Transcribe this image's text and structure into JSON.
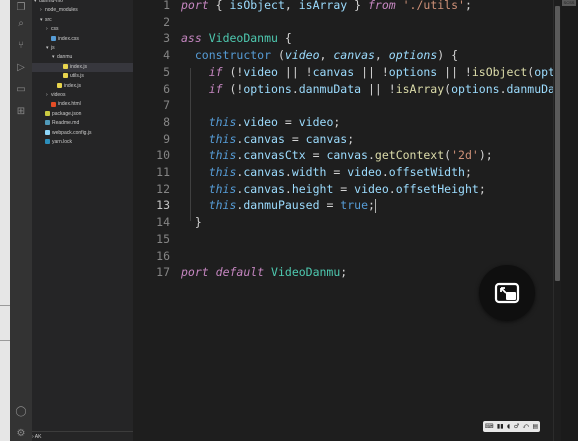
{
  "editor": {
    "lines": [
      {
        "n": "1",
        "tokens": [
          [
            "k",
            "port"
          ],
          [
            "o",
            " { "
          ],
          [
            "v",
            "isObject"
          ],
          [
            "o",
            ", "
          ],
          [
            "v",
            "isArray"
          ],
          [
            "o",
            " } "
          ],
          [
            "k",
            "from"
          ],
          [
            "o",
            " "
          ],
          [
            "s",
            "'./utils'"
          ],
          [
            "o",
            ";"
          ]
        ]
      },
      {
        "n": "2",
        "tokens": []
      },
      {
        "n": "3",
        "tokens": [
          [
            "k",
            "ass"
          ],
          [
            "o",
            " "
          ],
          [
            "c",
            "VideoDanmu"
          ],
          [
            "o",
            " {"
          ]
        ]
      },
      {
        "n": "4",
        "tokens": [
          [
            "o",
            "  "
          ],
          [
            "b",
            "constructor"
          ],
          [
            "o",
            " ("
          ],
          [
            "p",
            "video"
          ],
          [
            "o",
            ", "
          ],
          [
            "p",
            "canvas"
          ],
          [
            "o",
            ", "
          ],
          [
            "p",
            "options"
          ],
          [
            "o",
            ") {"
          ]
        ]
      },
      {
        "n": "5",
        "tokens": [
          [
            "o",
            "    "
          ],
          [
            "k",
            "if"
          ],
          [
            "o",
            " (!"
          ],
          [
            "v",
            "video"
          ],
          [
            "o",
            " || !"
          ],
          [
            "v",
            "canvas"
          ],
          [
            "o",
            " || !"
          ],
          [
            "v",
            "options"
          ],
          [
            "o",
            " || !"
          ],
          [
            "f",
            "isObject"
          ],
          [
            "o",
            "("
          ],
          [
            "v",
            "optio"
          ]
        ]
      },
      {
        "n": "6",
        "tokens": [
          [
            "o",
            "    "
          ],
          [
            "k",
            "if"
          ],
          [
            "o",
            " (!"
          ],
          [
            "v",
            "options"
          ],
          [
            "o",
            "."
          ],
          [
            "v",
            "danmuData"
          ],
          [
            "o",
            " || !"
          ],
          [
            "f",
            "isArray"
          ],
          [
            "o",
            "("
          ],
          [
            "v",
            "options"
          ],
          [
            "o",
            "."
          ],
          [
            "v",
            "danmuDat"
          ]
        ]
      },
      {
        "n": "7",
        "tokens": []
      },
      {
        "n": "8",
        "tokens": [
          [
            "o",
            "    "
          ],
          [
            "t",
            "this"
          ],
          [
            "o",
            "."
          ],
          [
            "v",
            "video"
          ],
          [
            "o",
            " = "
          ],
          [
            "v",
            "video"
          ],
          [
            "o",
            ";"
          ]
        ]
      },
      {
        "n": "9",
        "tokens": [
          [
            "o",
            "    "
          ],
          [
            "t",
            "this"
          ],
          [
            "o",
            "."
          ],
          [
            "v",
            "canvas"
          ],
          [
            "o",
            " = "
          ],
          [
            "v",
            "canvas"
          ],
          [
            "o",
            ";"
          ]
        ]
      },
      {
        "n": "10",
        "tokens": [
          [
            "o",
            "    "
          ],
          [
            "t",
            "this"
          ],
          [
            "o",
            "."
          ],
          [
            "v",
            "canvasCtx"
          ],
          [
            "o",
            " = "
          ],
          [
            "v",
            "canvas"
          ],
          [
            "o",
            "."
          ],
          [
            "f",
            "getContext"
          ],
          [
            "o",
            "("
          ],
          [
            "s",
            "'2d'"
          ],
          [
            "o",
            ");"
          ]
        ]
      },
      {
        "n": "11",
        "tokens": [
          [
            "o",
            "    "
          ],
          [
            "t",
            "this"
          ],
          [
            "o",
            "."
          ],
          [
            "v",
            "canvas"
          ],
          [
            "o",
            "."
          ],
          [
            "v",
            "width"
          ],
          [
            "o",
            " = "
          ],
          [
            "v",
            "video"
          ],
          [
            "o",
            "."
          ],
          [
            "v",
            "offsetWidth"
          ],
          [
            "o",
            ";"
          ]
        ]
      },
      {
        "n": "12",
        "tokens": [
          [
            "o",
            "    "
          ],
          [
            "t",
            "this"
          ],
          [
            "o",
            "."
          ],
          [
            "v",
            "canvas"
          ],
          [
            "o",
            "."
          ],
          [
            "v",
            "height"
          ],
          [
            "o",
            " = "
          ],
          [
            "v",
            "video"
          ],
          [
            "o",
            "."
          ],
          [
            "v",
            "offsetHeight"
          ],
          [
            "o",
            ";"
          ]
        ]
      },
      {
        "n": "13",
        "tokens": [
          [
            "o",
            "    "
          ],
          [
            "t",
            "this"
          ],
          [
            "o",
            "."
          ],
          [
            "v",
            "danmuPaused"
          ],
          [
            "o",
            " = "
          ],
          [
            "b",
            "true"
          ],
          [
            "o",
            ";"
          ]
        ],
        "cursor": true,
        "active": true
      },
      {
        "n": "14",
        "tokens": [
          [
            "o",
            "  }"
          ]
        ]
      },
      {
        "n": "15",
        "tokens": []
      },
      {
        "n": "16",
        "tokens": []
      },
      {
        "n": "17",
        "tokens": [
          [
            "k",
            "port"
          ],
          [
            "o",
            " "
          ],
          [
            "k",
            "default"
          ],
          [
            "o",
            " "
          ],
          [
            "c",
            "VideoDanmu"
          ],
          [
            "o",
            ";"
          ]
        ]
      }
    ]
  },
  "sidebar": {
    "items": [
      {
        "label": "danmu-mo",
        "indent": 0,
        "arrow": "▾",
        "icon": null,
        "selected": false
      },
      {
        "label": "node_modules",
        "indent": 1,
        "arrow": "›",
        "icon": null,
        "selected": false
      },
      {
        "label": "src",
        "indent": 1,
        "arrow": "▾",
        "icon": null,
        "selected": false
      },
      {
        "label": "css",
        "indent": 2,
        "arrow": "›",
        "icon": null,
        "selected": false
      },
      {
        "label": "index.css",
        "indent": 2,
        "arrow": "",
        "icon": "#569cd6",
        "selected": false
      },
      {
        "label": "js",
        "indent": 2,
        "arrow": "▾",
        "icon": null,
        "selected": false
      },
      {
        "label": "danmu",
        "indent": 3,
        "arrow": "▾",
        "icon": null,
        "selected": false
      },
      {
        "label": "index.js",
        "indent": 4,
        "arrow": "",
        "icon": "#e8d44d",
        "selected": true
      },
      {
        "label": "utils.js",
        "indent": 4,
        "arrow": "",
        "icon": "#e8d44d",
        "selected": false
      },
      {
        "label": "index.js",
        "indent": 3,
        "arrow": "",
        "icon": "#e8d44d",
        "selected": false
      },
      {
        "label": "videos",
        "indent": 2,
        "arrow": "›",
        "icon": null,
        "selected": false
      },
      {
        "label": "index.html",
        "indent": 2,
        "arrow": "",
        "icon": "#e44d26",
        "selected": false
      },
      {
        "label": "package.json",
        "indent": 1,
        "arrow": "",
        "icon": "#cbcb41",
        "selected": false
      },
      {
        "label": "Readme.md",
        "indent": 1,
        "arrow": "",
        "icon": "#519aba",
        "selected": false
      },
      {
        "label": "webpack.config.js",
        "indent": 1,
        "arrow": "",
        "icon": "#8dd6f9",
        "selected": false
      },
      {
        "label": "yarn.lock",
        "indent": 1,
        "arrow": "",
        "icon": "#2c8ebb",
        "selected": false
      }
    ],
    "bottom_label": "› AK"
  },
  "activity_icons": [
    "files-icon",
    "search-icon",
    "source-control-icon",
    "run-debug-icon",
    "remote-explorer-icon",
    "extensions-icon"
  ],
  "activity_bottom_icons": [
    "account-icon",
    "settings-gear-icon"
  ],
  "pip_button_icon": "picture-in-picture-icon",
  "mini_toolbar": [
    "⌨",
    "▮▮",
    "◖",
    "♂",
    "⤺",
    "▤"
  ],
  "right_badge": "SCSS"
}
